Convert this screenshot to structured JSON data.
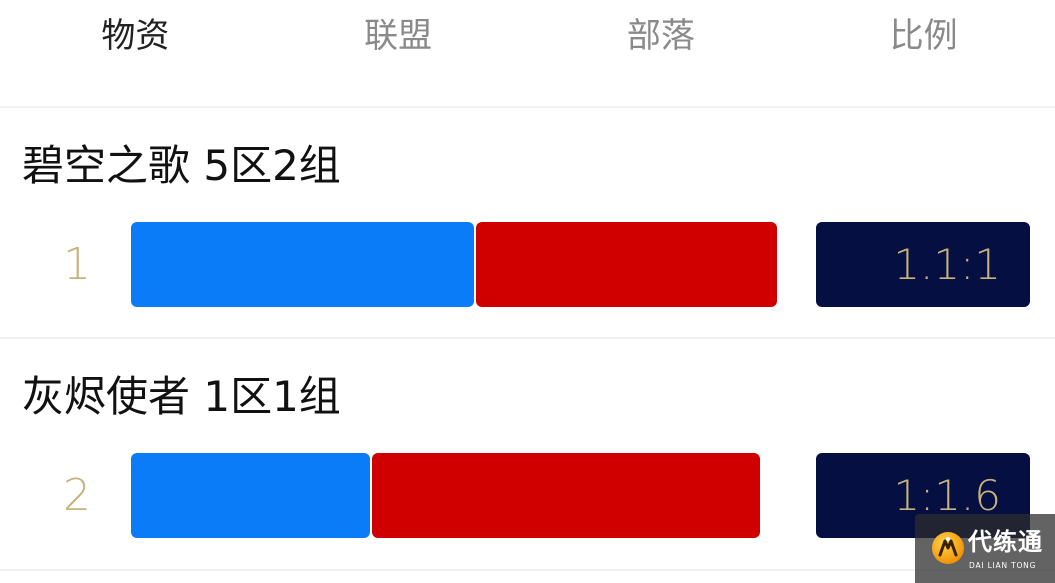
{
  "tabs": [
    {
      "label": "物资",
      "active": true
    },
    {
      "label": "联盟",
      "active": false
    },
    {
      "label": "部落",
      "active": false
    },
    {
      "label": "比例",
      "active": false
    }
  ],
  "colors": {
    "alliance": "#0a7cf7",
    "horde": "#d00000",
    "ratio_background": "#050f41",
    "accent_gold": "#c8b27d"
  },
  "rows": [
    {
      "rank": "1",
      "server": "碧空之歌 5区2组",
      "alliance_level": 0.531,
      "horde_level": 0.466,
      "ratio": "1.1:1"
    },
    {
      "rank": "2",
      "server": "灰烬使者 1区1组",
      "alliance_level": 0.37,
      "horde_level": 0.601,
      "ratio": "1:1.6"
    }
  ],
  "watermark": {
    "icon": "dai-lian-tong-logo-icon",
    "name": "代练通",
    "pinyin": "DAI LIAN TONG"
  }
}
